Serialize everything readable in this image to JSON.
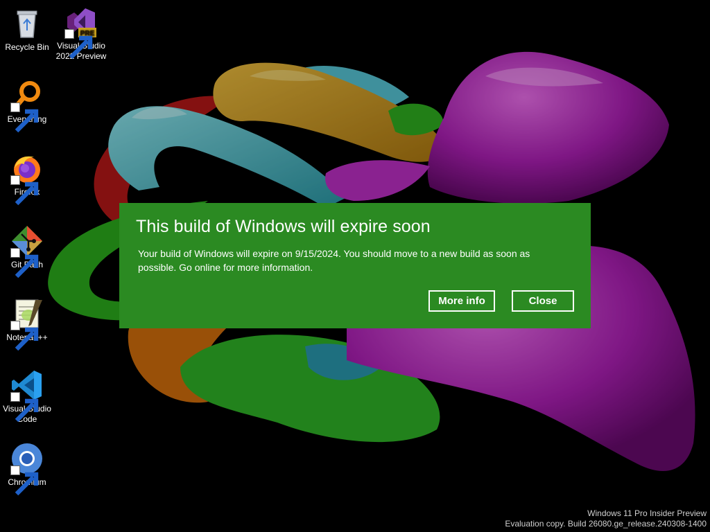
{
  "desktop": {
    "icons": [
      {
        "label": "Recycle Bin",
        "icon": "recycle-bin-icon"
      },
      {
        "label": "Visual Studio 2022 Preview",
        "icon": "visual-studio-icon",
        "badge": "PRE"
      },
      {
        "label": "Everything",
        "icon": "everything-search-icon"
      },
      {
        "label": "Firefox",
        "icon": "firefox-icon"
      },
      {
        "label": "Git Bash",
        "icon": "git-bash-icon"
      },
      {
        "label": "Notepad++",
        "icon": "notepad-plus-plus-icon"
      },
      {
        "label": "Visual Studio Code",
        "icon": "vscode-icon"
      },
      {
        "label": "Chromium",
        "icon": "chromium-icon"
      }
    ]
  },
  "dialog": {
    "title": "This build of Windows will expire soon",
    "body": "Your build of Windows will expire on 9/15/2024. You should move to a new build as soon as possible. Go online for more information.",
    "more_info_label": "More info",
    "close_label": "Close",
    "background_color": "#2b8a22"
  },
  "watermark": {
    "line1": "Windows 11 Pro Insider Preview",
    "line2": "Evaluation copy. Build 26080.ge_release.240308-1400"
  }
}
